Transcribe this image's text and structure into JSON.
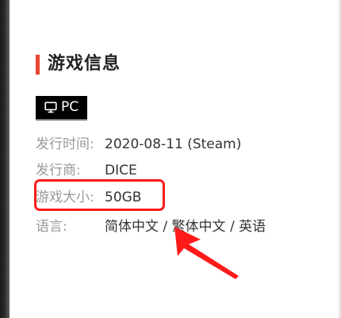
{
  "section": {
    "title": "游戏信息"
  },
  "platform": {
    "label": "PC",
    "icon": "monitor-icon"
  },
  "info_rows": [
    {
      "label": "发行时间:",
      "value": "2020-08-11 (Steam)"
    },
    {
      "label": "发行商:",
      "value": "DICE"
    },
    {
      "label": "游戏大小:",
      "value": "50GB"
    },
    {
      "label": "语言:",
      "value": "简体中文 / 繁体中文 / 英语"
    }
  ],
  "colors": {
    "accent": "#e8472f",
    "annotation": "#ff1a1a",
    "label": "#9a9a9a",
    "value": "#333333",
    "badge_background": "#000000"
  }
}
